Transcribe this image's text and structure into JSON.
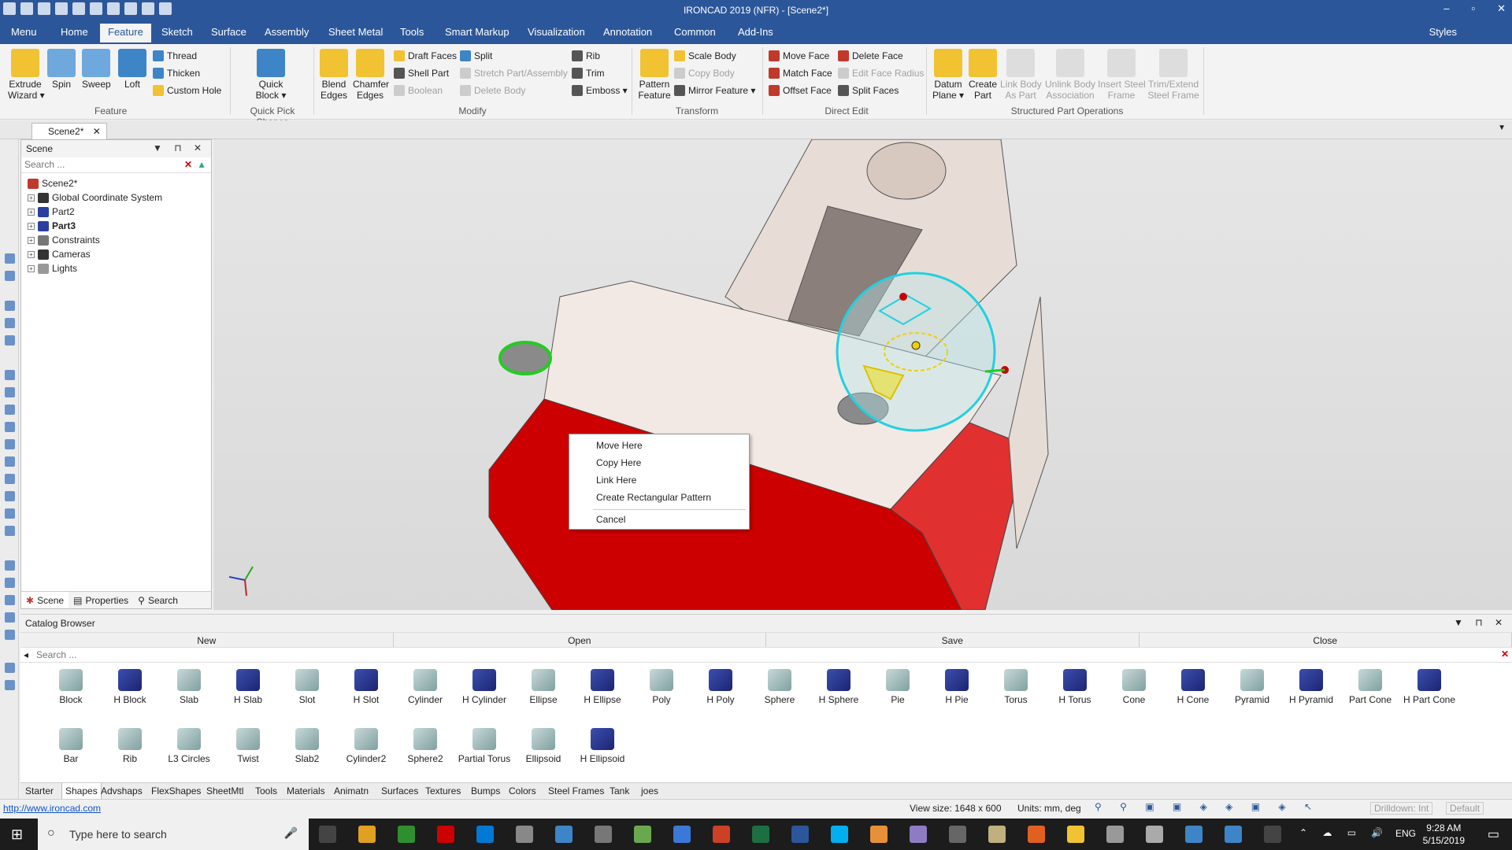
{
  "app": {
    "title": "IRONCAD 2019 (NFR) - [Scene2*]",
    "min": "–",
    "max": "▫",
    "close": "✕"
  },
  "menu": {
    "tabs": [
      "Menu",
      "Home",
      "Feature",
      "Sketch",
      "Surface",
      "Assembly",
      "Sheet Metal",
      "Tools",
      "Smart Markup",
      "Visualization",
      "Annotation",
      "Common",
      "Add-Ins"
    ],
    "active": "Feature",
    "styles": "Styles"
  },
  "ribbon": {
    "feature": {
      "extrude": "Extrude\nWizard ▾",
      "spin": "Spin",
      "sweep": "Sweep",
      "loft": "Loft",
      "thread": "Thread",
      "thicken": "Thicken",
      "custom_hole": "Custom Hole",
      "group": "Feature"
    },
    "quick": {
      "block": "Quick\nBlock ▾",
      "group": "Quick Pick Shapes"
    },
    "modify": {
      "blend": "Blend\nEdges",
      "chamfer": "Chamfer\nEdges",
      "draft": "Draft Faces",
      "shell": "Shell Part",
      "boolean": "Boolean",
      "split": "Split",
      "stretch": "Stretch Part/Assembly",
      "delete_body": "Delete Body",
      "rib": "Rib",
      "trim": "Trim",
      "emboss": "Emboss ▾",
      "group": "Modify"
    },
    "transform": {
      "pattern": "Pattern\nFeature",
      "scale": "Scale Body",
      "copy": "Copy Body",
      "mirror": "Mirror Feature ▾",
      "group": "Transform"
    },
    "direct": {
      "move_face": "Move Face",
      "match_face": "Match Face",
      "offset_face": "Offset Face",
      "delete_face": "Delete Face",
      "edit_radius": "Edit Face Radius",
      "split_faces": "Split Faces",
      "group": "Direct Edit"
    },
    "structured": {
      "datum": "Datum\nPlane ▾",
      "create_part": "Create\nPart",
      "link_body": "Link Body\nAs Part",
      "unlink": "Unlink Body\nAssociation",
      "insert_steel": "Insert Steel\nFrame",
      "trim_extend": "Trim/Extend\nSteel Frame",
      "group": "Structured Part Operations"
    }
  },
  "doc_tab": "Scene2*",
  "scene_panel": {
    "title": "Scene",
    "search_placeholder": "Search ...",
    "tree": [
      {
        "label": "Scene2*",
        "bold": false
      },
      {
        "label": "Global Coordinate System",
        "bold": false
      },
      {
        "label": "Part2",
        "bold": false
      },
      {
        "label": "Part3",
        "bold": true
      },
      {
        "label": "Constraints",
        "bold": false
      },
      {
        "label": "Cameras",
        "bold": false
      },
      {
        "label": "Lights",
        "bold": false
      }
    ],
    "bottom_tabs": [
      "Scene",
      "Properties",
      "Search"
    ]
  },
  "context_menu": [
    "Move Here",
    "Copy Here",
    "Link Here",
    "Create Rectangular Pattern",
    "Cancel"
  ],
  "catalog": {
    "title": "Catalog Browser",
    "toolbar": [
      "New",
      "Open",
      "Save",
      "Close"
    ],
    "search_placeholder": "Search ...",
    "row1": [
      "Block",
      "H Block",
      "Slab",
      "H Slab",
      "Slot",
      "H Slot",
      "Cylinder",
      "H Cylinder",
      "Ellipse",
      "H Ellipse",
      "Poly",
      "H Poly",
      "Sphere",
      "H Sphere",
      "Pie",
      "H Pie",
      "Torus",
      "H Torus",
      "Cone",
      "H Cone",
      "Pyramid",
      "H Pyramid",
      "Part Cone",
      "H Part Cone"
    ],
    "row2": [
      "Bar",
      "Rib",
      "L3 Circles",
      "Twist",
      "Slab2",
      "Cylinder2",
      "Sphere2",
      "Partial Torus",
      "Ellipsoid",
      "H Ellipsoid"
    ],
    "tabs": [
      "Starter",
      "Shapes",
      "Advshaps",
      "FlexShapes",
      "SheetMtl",
      "Tools",
      "Materials",
      "Animatn",
      "Surfaces",
      "Textures",
      "Bumps",
      "Colors",
      "Steel Frames",
      "Tank",
      "joes"
    ],
    "active_tab": "Shapes"
  },
  "status": {
    "url": "http://www.ironcad.com",
    "view_size": "View size: 1648 x 600",
    "units": "Units: mm, deg",
    "drilldown": "Drilldown: Int",
    "default": "Default"
  },
  "taskbar": {
    "search_placeholder": "Type here to search",
    "lang": "ENG",
    "time": "9:28 AM",
    "date": "5/15/2019"
  }
}
